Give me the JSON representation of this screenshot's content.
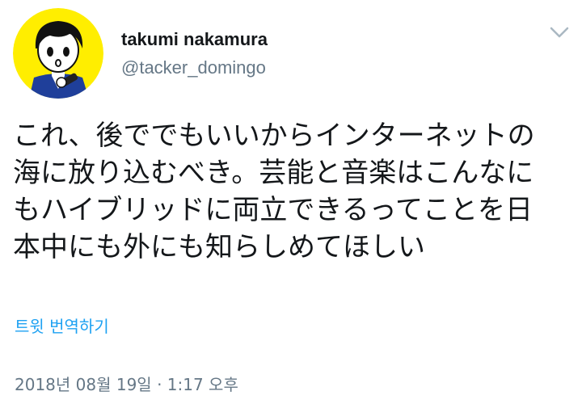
{
  "user": {
    "display_name": "takumi nakamura",
    "handle": "@tacker_domingo",
    "avatar_icon": "cartoon-avatar-icon",
    "avatar_bg": "#ffee00"
  },
  "tweet": {
    "text": "これ、後ででもいいからインターネットの\n海に放り込むべき。芸能と音楽はこんなに\nもハイブリッドに両立できるってことを日\n本中にも外にも知らしめてほしい",
    "translate_label": "트윗 번역하기",
    "timestamp": "2018년 08월 19일 · 1:17 오후"
  },
  "menu": {
    "caret_icon": "chevron-down-icon"
  },
  "colors": {
    "link": "#1da1f2",
    "secondary": "#657786",
    "primary_text": "#14171a"
  }
}
